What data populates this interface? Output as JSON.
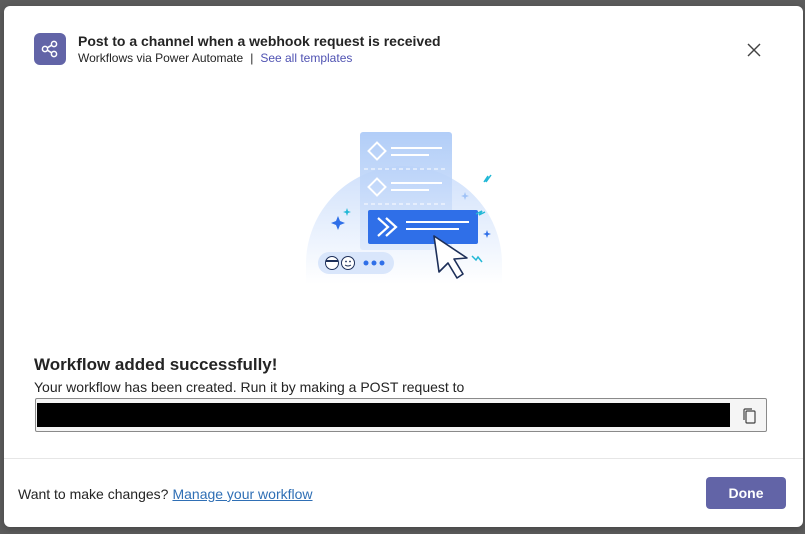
{
  "header": {
    "title": "Post to a channel when a webhook request is received",
    "subtitle": "Workflows via Power Automate",
    "separator": "|",
    "templates_link": "See all templates",
    "app_icon": "share-nodes-icon",
    "close_icon": "close-icon"
  },
  "main": {
    "success_title": "Workflow added successfully!",
    "description": "Your workflow has been created. Run it by making a POST request to",
    "url_value": "",
    "copy_icon": "copy-icon"
  },
  "footer": {
    "prompt": "Want to make changes?",
    "manage_link": "Manage your workflow",
    "done_label": "Done"
  },
  "colors": {
    "brand": "#6264a7",
    "link": "#2f6fb5",
    "illustration_blue": "#3b82f6"
  }
}
